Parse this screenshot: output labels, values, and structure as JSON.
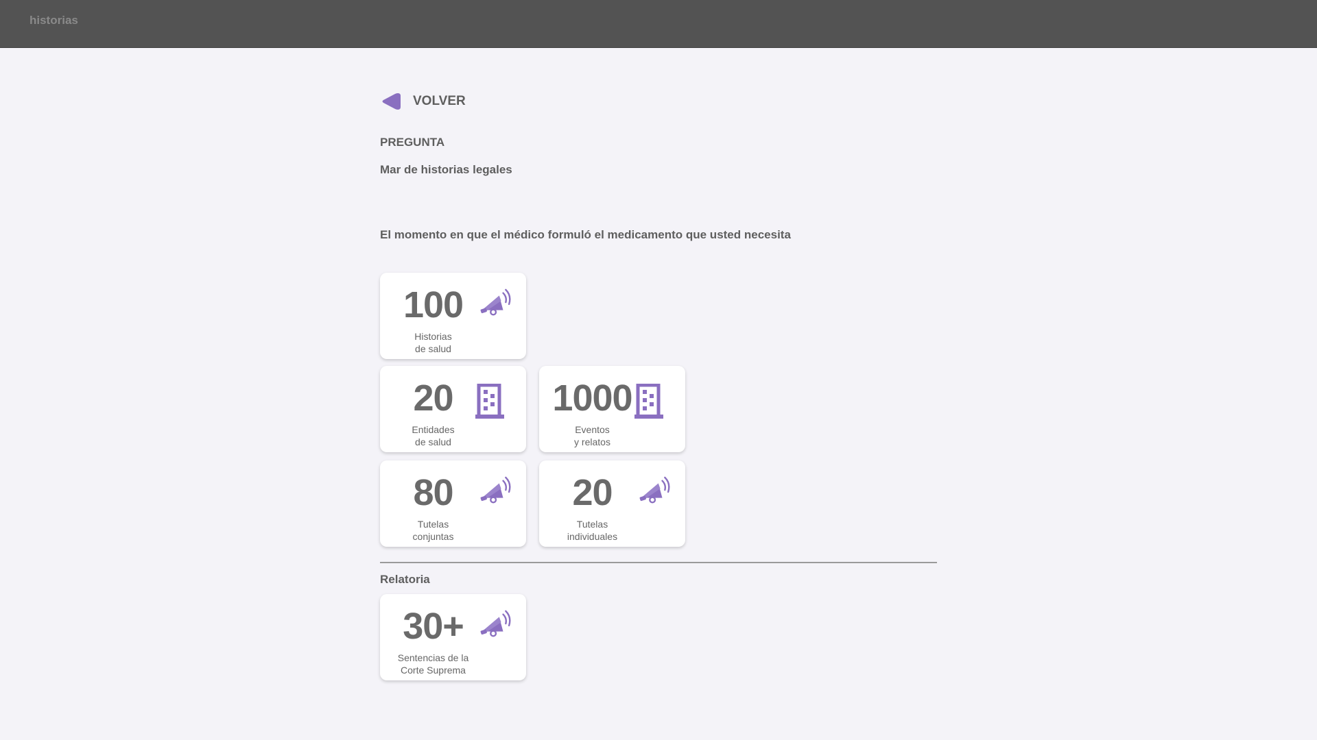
{
  "app": {
    "brand": "historias"
  },
  "nav": {
    "back_label": "VOLVER"
  },
  "question": {
    "label": "PREGUNTA",
    "subtitle": "Mar de historias legales",
    "text": "El momento en que el médico formuló el medicamento que usted necesita"
  },
  "cards": [
    {
      "value": "100",
      "label_line1": "Historias",
      "label_line2": "de salud",
      "icon": "megaphone-icon"
    },
    {
      "value": "20",
      "label_line1": "Entidades",
      "label_line2": "de salud",
      "icon": "building-icon"
    },
    {
      "value": "1000",
      "label_line1": "Eventos",
      "label_line2": "y relatos",
      "icon": "building-icon"
    },
    {
      "value": "80",
      "label_line1": "Tutelas",
      "label_line2": "conjuntas",
      "icon": "megaphone-icon"
    },
    {
      "value": "20",
      "label_line1": "Tutelas",
      "label_line2": "individuales",
      "icon": "megaphone-icon"
    }
  ],
  "relatoria": {
    "title": "Relatoria",
    "card": {
      "value": "30+",
      "label_line1": "Sentencias de la",
      "label_line2": "Corte Suprema",
      "icon": "megaphone-icon"
    }
  },
  "colors": {
    "accent": "#8a6fc0",
    "topbar": "#535353",
    "background": "#f4f3f8"
  }
}
